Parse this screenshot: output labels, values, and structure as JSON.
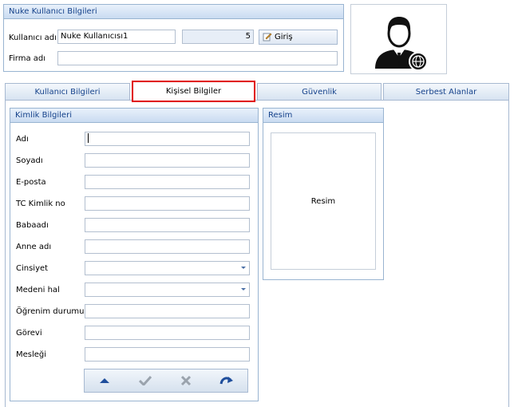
{
  "header": {
    "group_title": "Nuke Kullanıcı Bilgileri",
    "username_label": "Kullanıcı adı",
    "username_value": "Nuke Kullanıcısı1",
    "id_value": "5",
    "login_button": "Giriş",
    "company_label": "Firma adı",
    "company_value": ""
  },
  "tabs": [
    {
      "label": "Kullanıcı Bilgileri",
      "active": false
    },
    {
      "label": "Kişisel Bilgiler",
      "active": true
    },
    {
      "label": "Güvenlik",
      "active": false
    },
    {
      "label": "Serbest Alanlar",
      "active": false
    }
  ],
  "identity": {
    "title": "Kimlik Bilgileri",
    "fields": [
      {
        "label": "Adı",
        "value": "",
        "type": "text"
      },
      {
        "label": "Soyadı",
        "value": "",
        "type": "text"
      },
      {
        "label": "E-posta",
        "value": "",
        "type": "text"
      },
      {
        "label": "TC Kimlik no",
        "value": "",
        "type": "text"
      },
      {
        "label": "Babaadı",
        "value": "",
        "type": "text"
      },
      {
        "label": "Anne adı",
        "value": "",
        "type": "text"
      },
      {
        "label": "Cinsiyet",
        "value": "",
        "type": "combo"
      },
      {
        "label": "Medeni hal",
        "value": "",
        "type": "combo"
      },
      {
        "label": "Öğrenim durumu",
        "value": "",
        "type": "text"
      },
      {
        "label": "Görevi",
        "value": "",
        "type": "text"
      },
      {
        "label": "Mesleği",
        "value": "",
        "type": "text"
      }
    ],
    "nav_icons": [
      "arrow-up-icon",
      "check-icon",
      "cross-icon",
      "redo-icon"
    ]
  },
  "picture": {
    "title": "Resim",
    "placeholder": "Resim"
  },
  "colors": {
    "header_text": "#15428b",
    "border": "#99b4d1",
    "active_tab_border": "#e00000",
    "nav_icon": "#1f4e9c"
  }
}
